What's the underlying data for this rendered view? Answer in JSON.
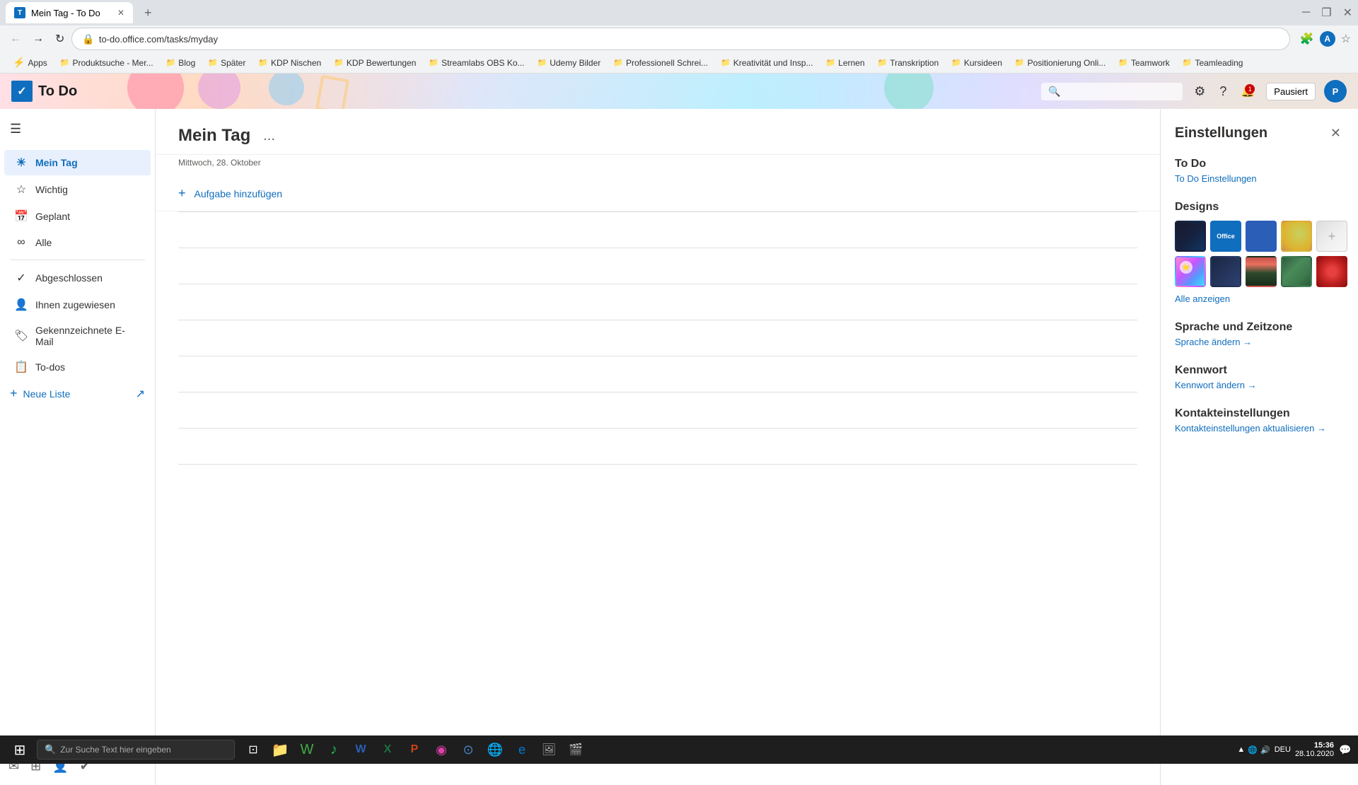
{
  "browser": {
    "tab_title": "Mein Tag - To Do",
    "url": "to-do.office.com/tasks/myday",
    "new_tab_label": "+",
    "nav": {
      "back": "←",
      "forward": "→",
      "refresh": "↻"
    }
  },
  "bookmarks": {
    "items_label": "Apps",
    "items": [
      {
        "label": "Produktsuche - Mer...",
        "has_folder": true
      },
      {
        "label": "Blog",
        "has_folder": true
      },
      {
        "label": "Später",
        "has_folder": true
      },
      {
        "label": "KDP Nischen",
        "has_folder": true
      },
      {
        "label": "KDP Bewertungen",
        "has_folder": true
      },
      {
        "label": "Streamlabs OBS Ko...",
        "has_folder": true
      },
      {
        "label": "Udemy Bilder",
        "has_folder": true
      },
      {
        "label": "Professionell Schrei...",
        "has_folder": true
      },
      {
        "label": "Kreativität und Insp...",
        "has_folder": true
      },
      {
        "label": "Lernen",
        "has_folder": true
      },
      {
        "label": "Transkription",
        "has_folder": true
      },
      {
        "label": "Kursideen",
        "has_folder": true
      },
      {
        "label": "Positionierung Onli...",
        "has_folder": true
      },
      {
        "label": "Teamwork",
        "has_folder": true
      },
      {
        "label": "Teamleading",
        "has_folder": true
      }
    ]
  },
  "app_header": {
    "logo": "To Do",
    "pause_btn": "Pausiert"
  },
  "sidebar": {
    "menu_icon": "☰",
    "items": [
      {
        "label": "Mein Tag",
        "icon": "☀",
        "active": true
      },
      {
        "label": "Wichtig",
        "icon": "★",
        "active": false
      },
      {
        "label": "Geplant",
        "icon": "📅",
        "active": false
      },
      {
        "label": "Alle",
        "icon": "∞",
        "active": false
      },
      {
        "label": "Abgeschlossen",
        "icon": "✓",
        "active": false
      },
      {
        "label": "Ihnen zugewiesen",
        "icon": "👤",
        "active": false
      },
      {
        "label": "Gekennzeichnete E-Mail",
        "icon": "📧",
        "active": false
      },
      {
        "label": "To-dos",
        "icon": "📋",
        "active": false
      }
    ],
    "new_list_label": "Neue Liste",
    "new_list_icon": "↗"
  },
  "content": {
    "title": "Mein Tag",
    "more_btn": "...",
    "date": "Mittwoch, 28. Oktober",
    "add_task_label": "Aufgabe hinzufügen",
    "add_task_icon": "+"
  },
  "settings": {
    "title": "Einstellungen",
    "close_icon": "✕",
    "todo_section": {
      "title": "To Do",
      "link": "To Do Einstellungen"
    },
    "designs_section": {
      "title": "Designs",
      "show_all": "Alle anzeigen",
      "designs": [
        {
          "name": "dark-circuit",
          "label": "Dunkles Circuit Design",
          "selected": false
        },
        {
          "name": "office",
          "label": "Office",
          "selected": true
        },
        {
          "name": "blue",
          "label": "Blau",
          "selected": false
        },
        {
          "name": "abstract1",
          "label": "Abstract",
          "selected": false
        },
        {
          "name": "white",
          "label": "Weiß",
          "selected": false
        },
        {
          "name": "colorful",
          "label": "Bunt",
          "selected": false
        },
        {
          "name": "dark-blue",
          "label": "Dunkelblau",
          "selected": false
        },
        {
          "name": "mountains",
          "label": "Berge",
          "selected": false
        },
        {
          "name": "green-pattern",
          "label": "Grünes Muster",
          "selected": false
        },
        {
          "name": "red-circle",
          "label": "Roter Kreis",
          "selected": false
        }
      ]
    },
    "language_section": {
      "title": "Sprache und Zeitzone",
      "link": "Sprache ändern →"
    },
    "password_section": {
      "title": "Kennwort",
      "link": "Kennwort ändern →"
    },
    "contact_section": {
      "title": "Kontakteinstellungen",
      "link": "Kontakteinstellungen aktualisieren →"
    }
  },
  "taskbar": {
    "search_placeholder": "Zur Suche Text hier eingeben",
    "clock_time": "15:36",
    "clock_date": "28.10.2020",
    "language": "DEU",
    "notification_badge": "1"
  }
}
